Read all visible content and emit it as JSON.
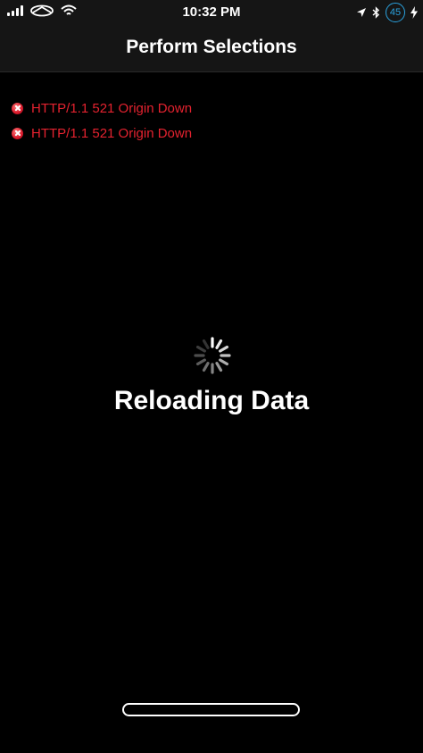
{
  "status_bar": {
    "time": "10:32 PM",
    "badge": "45",
    "icons": {
      "left": [
        "signal-icon",
        "infiniti-logo-icon",
        "wifi-icon"
      ],
      "right": [
        "location-arrow-icon",
        "bluetooth-icon",
        "badge-45-icon",
        "charging-bolt-icon"
      ]
    }
  },
  "nav": {
    "title": "Perform Selections"
  },
  "errors": [
    {
      "icon": "error-x-icon",
      "text": "HTTP/1.1 521 Origin Down"
    },
    {
      "icon": "error-x-icon",
      "text": "HTTP/1.1 521 Origin Down"
    }
  ],
  "loading": {
    "icon": "activity-spinner-icon",
    "text": "Reloading Data"
  },
  "colors": {
    "background": "#000000",
    "bar": "#151515",
    "error_red": "#e4222f",
    "badge_blue": "#2ba3e0",
    "text": "#ffffff"
  }
}
